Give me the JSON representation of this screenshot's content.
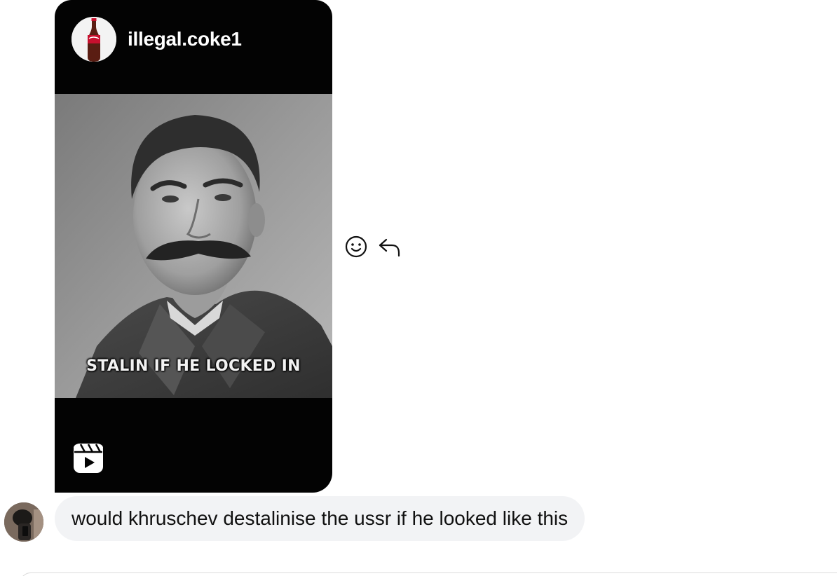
{
  "shared_reel": {
    "author_username": "illegal.coke1",
    "caption_overlay": "STALIN IF HE LOCKED IN",
    "author_avatar_icon": "coca-cola-bottle-avatar",
    "reel_badge_icon": "reels-icon"
  },
  "message_actions": {
    "react_icon": "smiley-icon",
    "reply_icon": "reply-arrow-icon"
  },
  "text_message": {
    "text": "would khruschev destalinise the ussr if he looked like this"
  },
  "colors": {
    "card_background": "#030303",
    "bubble_background": "#f2f3f5",
    "text_primary": "#111111"
  }
}
